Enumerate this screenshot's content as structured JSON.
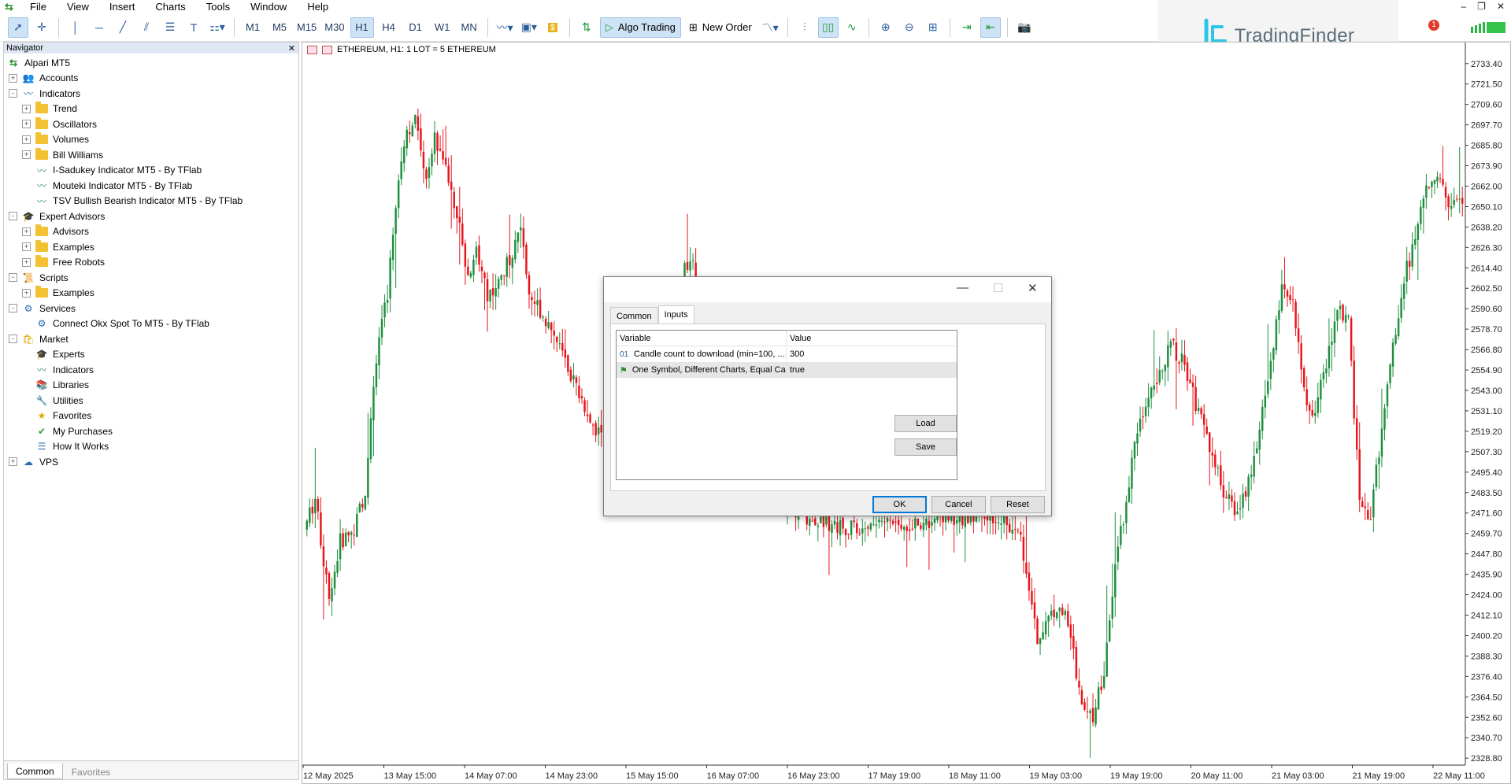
{
  "menu": [
    "File",
    "View",
    "Insert",
    "Charts",
    "Tools",
    "Window",
    "Help"
  ],
  "toolbar": {
    "timeframes": [
      "M1",
      "M5",
      "M15",
      "M30",
      "H1",
      "H4",
      "D1",
      "W1",
      "MN"
    ],
    "active_timeframe": "H1",
    "algo_trading": "Algo Trading",
    "new_order": "New Order"
  },
  "brand": {
    "name": "TradingFinder",
    "notification_count": "1",
    "accent": "#2ec5e8"
  },
  "navigator": {
    "title": "Navigator",
    "root": "Alpari MT5",
    "items": [
      {
        "label": "Accounts",
        "level": 1,
        "expander": "+",
        "icon": "accounts-icon"
      },
      {
        "label": "Indicators",
        "level": 1,
        "expander": "-",
        "icon": "indicators-icon"
      },
      {
        "label": "Trend",
        "level": 2,
        "expander": "+",
        "icon": "folder-icon"
      },
      {
        "label": "Oscillators",
        "level": 2,
        "expander": "+",
        "icon": "folder-icon"
      },
      {
        "label": "Volumes",
        "level": 2,
        "expander": "+",
        "icon": "folder-icon"
      },
      {
        "label": "Bill Williams",
        "level": 2,
        "expander": "+",
        "icon": "folder-icon"
      },
      {
        "label": "I-Sadukey Indicator MT5 - By TFlab",
        "level": 2,
        "expander": "",
        "icon": "indicator-icon"
      },
      {
        "label": "Mouteki Indicator MT5 - By TFlab",
        "level": 2,
        "expander": "",
        "icon": "indicator-icon"
      },
      {
        "label": "TSV Bullish Bearish Indicator MT5 - By TFlab",
        "level": 2,
        "expander": "",
        "icon": "indicator-icon"
      },
      {
        "label": "Expert Advisors",
        "level": 1,
        "expander": "-",
        "icon": "expert-icon"
      },
      {
        "label": "Advisors",
        "level": 2,
        "expander": "+",
        "icon": "folder-icon"
      },
      {
        "label": "Examples",
        "level": 2,
        "expander": "+",
        "icon": "folder-icon"
      },
      {
        "label": "Free Robots",
        "level": 2,
        "expander": "+",
        "icon": "folder-icon"
      },
      {
        "label": "Scripts",
        "level": 1,
        "expander": "-",
        "icon": "scripts-icon"
      },
      {
        "label": "Examples",
        "level": 2,
        "expander": "+",
        "icon": "folder-icon"
      },
      {
        "label": "Services",
        "level": 1,
        "expander": "-",
        "icon": "services-icon"
      },
      {
        "label": "Connect Okx Spot To MT5 - By TFlab",
        "level": 2,
        "expander": "",
        "icon": "service-icon"
      },
      {
        "label": "Market",
        "level": 1,
        "expander": "-",
        "icon": "market-icon"
      },
      {
        "label": "Experts",
        "level": 2,
        "expander": "",
        "icon": "expert-icon"
      },
      {
        "label": "Indicators",
        "level": 2,
        "expander": "",
        "icon": "indicator-icon"
      },
      {
        "label": "Libraries",
        "level": 2,
        "expander": "",
        "icon": "library-icon"
      },
      {
        "label": "Utilities",
        "level": 2,
        "expander": "",
        "icon": "utility-icon"
      },
      {
        "label": "Favorites",
        "level": 2,
        "expander": "",
        "icon": "star-icon"
      },
      {
        "label": "My Purchases",
        "level": 2,
        "expander": "",
        "icon": "check-icon"
      },
      {
        "label": "How It Works",
        "level": 2,
        "expander": "",
        "icon": "doc-icon"
      },
      {
        "label": "VPS",
        "level": 1,
        "expander": "+",
        "icon": "cloud-icon"
      }
    ],
    "tabs": [
      "Common",
      "Favorites"
    ],
    "active_tab": "Common"
  },
  "chart": {
    "title": "ETHEREUM, H1:  1 LOT = 5 ETHEREUM",
    "bull_color": "#1e8f3e",
    "bear_color": "#e8141b"
  },
  "chart_data": {
    "type": "candlestick",
    "y_ticks": [
      "2733.40",
      "2721.50",
      "2709.60",
      "2697.70",
      "2685.80",
      "2673.90",
      "2662.00",
      "2650.10",
      "2638.20",
      "2626.30",
      "2614.40",
      "2602.50",
      "2590.60",
      "2578.70",
      "2566.80",
      "2554.90",
      "2543.00",
      "2531.10",
      "2519.20",
      "2507.30",
      "2495.40",
      "2483.50",
      "2471.60",
      "2459.70",
      "2447.80",
      "2435.90",
      "2424.00",
      "2412.10",
      "2400.20",
      "2388.30",
      "2376.40",
      "2364.50",
      "2352.60",
      "2340.70",
      "2328.80"
    ],
    "x_ticks": [
      "12 May 2025",
      "13 May 15:00",
      "14 May 07:00",
      "14 May 23:00",
      "15 May 15:00",
      "16 May 07:00",
      "16 May 23:00",
      "17 May 19:00",
      "18 May 11:00",
      "19 May 03:00",
      "19 May 19:00",
      "20 May 11:00",
      "21 May 03:00",
      "21 May 19:00",
      "22 May 11:00"
    ],
    "ylim": [
      2322,
      2742
    ],
    "price_path": [
      [
        0,
        2462
      ],
      [
        4,
        2480
      ],
      [
        9,
        2420
      ],
      [
        13,
        2455
      ],
      [
        18,
        2462
      ],
      [
        22,
        2485
      ],
      [
        26,
        2560
      ],
      [
        30,
        2600
      ],
      [
        34,
        2670
      ],
      [
        37,
        2695
      ],
      [
        40,
        2700
      ],
      [
        44,
        2668
      ],
      [
        47,
        2690
      ],
      [
        50,
        2680
      ],
      [
        53,
        2660
      ],
      [
        56,
        2640
      ],
      [
        59,
        2610
      ],
      [
        62,
        2625
      ],
      [
        66,
        2600
      ],
      [
        70,
        2605
      ],
      [
        74,
        2620
      ],
      [
        78,
        2640
      ],
      [
        81,
        2600
      ],
      [
        85,
        2590
      ],
      [
        90,
        2575
      ],
      [
        94,
        2560
      ],
      [
        98,
        2545
      ],
      [
        105,
        2520
      ],
      [
        112,
        2510
      ],
      [
        120,
        2505
      ],
      [
        128,
        2512
      ],
      [
        134,
        2560
      ],
      [
        137,
        2620
      ],
      [
        140,
        2614
      ],
      [
        144,
        2590
      ],
      [
        150,
        2560
      ],
      [
        160,
        2520
      ],
      [
        170,
        2480
      ],
      [
        180,
        2470
      ],
      [
        190,
        2465
      ],
      [
        200,
        2462
      ],
      [
        210,
        2468
      ],
      [
        220,
        2465
      ],
      [
        230,
        2470
      ],
      [
        240,
        2468
      ],
      [
        250,
        2470
      ],
      [
        258,
        2455
      ],
      [
        264,
        2400
      ],
      [
        268,
        2410
      ],
      [
        272,
        2420
      ],
      [
        276,
        2400
      ],
      [
        280,
        2360
      ],
      [
        284,
        2352
      ],
      [
        288,
        2380
      ],
      [
        292,
        2440
      ],
      [
        296,
        2480
      ],
      [
        300,
        2520
      ],
      [
        304,
        2540
      ],
      [
        308,
        2555
      ],
      [
        312,
        2570
      ],
      [
        316,
        2560
      ],
      [
        320,
        2540
      ],
      [
        324,
        2520
      ],
      [
        328,
        2500
      ],
      [
        332,
        2480
      ],
      [
        336,
        2472
      ],
      [
        340,
        2490
      ],
      [
        344,
        2520
      ],
      [
        348,
        2560
      ],
      [
        352,
        2600
      ],
      [
        356,
        2595
      ],
      [
        360,
        2540
      ],
      [
        364,
        2530
      ],
      [
        368,
        2560
      ],
      [
        372,
        2590
      ],
      [
        376,
        2582
      ],
      [
        380,
        2480
      ],
      [
        384,
        2470
      ],
      [
        388,
        2520
      ],
      [
        392,
        2570
      ],
      [
        396,
        2610
      ],
      [
        400,
        2630
      ],
      [
        404,
        2660
      ],
      [
        408,
        2670
      ],
      [
        412,
        2650
      ],
      [
        416,
        2655
      ]
    ]
  },
  "dialog": {
    "tabs": [
      "Common",
      "Inputs"
    ],
    "active_tab": "Inputs",
    "columns": [
      "Variable",
      "Value"
    ],
    "rows": [
      {
        "type": "01",
        "variable": "Candle count to download (min=100, ...",
        "value": "300"
      },
      {
        "type": "bool",
        "variable": "One Symbol, Different Charts, Equal Ca...",
        "value": "true"
      }
    ],
    "buttons": {
      "load": "Load",
      "save": "Save",
      "ok": "OK",
      "cancel": "Cancel",
      "reset": "Reset"
    }
  }
}
